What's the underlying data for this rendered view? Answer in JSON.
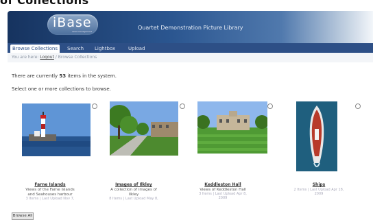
{
  "page_heading": "of Collections",
  "header": {
    "logo_text": "iBase",
    "logo_subtext": "asset management",
    "site_title": "Quartet Demonstration Picture Library"
  },
  "nav": {
    "tabs": [
      {
        "label": "Browse Collections"
      },
      {
        "label": "Search"
      },
      {
        "label": "Lightbox"
      },
      {
        "label": "Upload"
      }
    ]
  },
  "breadcrumb": {
    "prefix": "You are here:",
    "link": "Logout",
    "separator": "/",
    "current": "Browse Collections"
  },
  "intro": {
    "count_prefix": "There are currently",
    "count": "53",
    "count_suffix": "items in the system.",
    "instruction": "Select one or more collections to browse."
  },
  "collections": [
    {
      "title": "Farne Islands",
      "desc_line1": "Views of the Farne Islands",
      "desc_line2": "and Seahouses harbour",
      "meta_line1": "3 Items | Last Upload Nov 7,",
      "meta_line2": ""
    },
    {
      "title": "Images of Ilkley",
      "desc_line1": "A collection of images of",
      "desc_line2": "Ilkley",
      "meta_line1": "8 Items | Last Upload May 8,",
      "meta_line2": ""
    },
    {
      "title": "Keddleston Hall",
      "desc_line1": "Views of Keddleston Hall",
      "desc_line2": "",
      "meta_line1": "3 Items | Last Upload Apr 8,",
      "meta_line2": "2009"
    },
    {
      "title": "Ships",
      "desc_line1": "",
      "desc_line2": "",
      "meta_line1": "2 Items | Last Upload Apr 18,",
      "meta_line2": "2009"
    }
  ],
  "browse_button": "Browse All"
}
